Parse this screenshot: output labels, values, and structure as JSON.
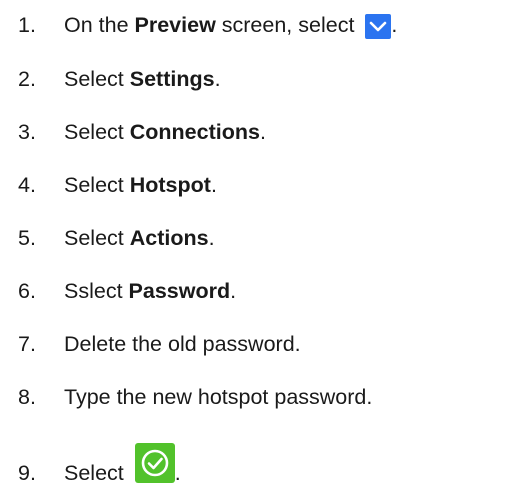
{
  "steps": [
    {
      "num": "1.",
      "pre": "On the ",
      "bold": "Preview",
      "post": " screen, select ",
      "icon": "chevron-down-icon",
      "tail": "."
    },
    {
      "num": "2.",
      "pre": "Select ",
      "bold": "Settings",
      "post": "."
    },
    {
      "num": "3.",
      "pre": "Select ",
      "bold": "Connections",
      "post": "."
    },
    {
      "num": "4.",
      "pre": "Select ",
      "bold": "Hotspot",
      "post": "."
    },
    {
      "num": "5.",
      "pre": "Select ",
      "bold": "Actions",
      "post": "."
    },
    {
      "num": "6.",
      "pre": "Sslect ",
      "bold": "Password",
      "post": "."
    },
    {
      "num": "7.",
      "text": "Delete the old password."
    },
    {
      "num": "8.",
      "text": "Type the new hotspot password."
    },
    {
      "num": "9.",
      "pre": "Select ",
      "icon": "check-circle-icon",
      "tail": "."
    }
  ],
  "colors": {
    "chevron_bg": "#2b74f0",
    "check_bg": "#52c22b",
    "text": "#1a1a1a"
  }
}
